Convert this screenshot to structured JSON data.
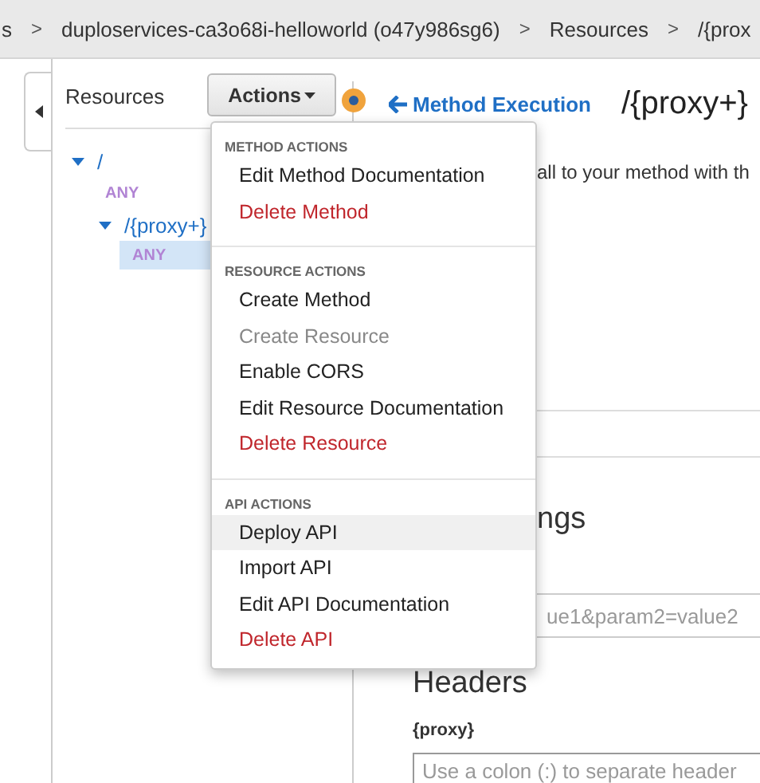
{
  "breadcrumb": [
    {
      "kind": "crumb",
      "text": "s"
    },
    {
      "kind": "separator",
      "text": ">"
    },
    {
      "kind": "crumb",
      "text": "duploservices-ca3o68i-helloworld (o47y986sg6)"
    },
    {
      "kind": "separator",
      "text": ">"
    },
    {
      "kind": "crumb",
      "text": "Resources"
    },
    {
      "kind": "separator",
      "text": ">"
    },
    {
      "kind": "crumb",
      "text": "/{prox"
    }
  ],
  "resources": {
    "title": "Resources",
    "actions_button": "Actions",
    "tree": [
      {
        "label": "/",
        "kind": "resource",
        "expanded": true,
        "selected": false,
        "children": [
          {
            "label": "ANY",
            "kind": "method",
            "selected": false
          },
          {
            "label": "/{proxy+}",
            "kind": "resource",
            "expanded": true,
            "selected": false,
            "children": [
              {
                "label": "ANY",
                "kind": "method",
                "selected": true
              }
            ]
          }
        ]
      }
    ]
  },
  "menu": {
    "sections": [
      {
        "title": "METHOD ACTIONS",
        "items": [
          {
            "label": "Edit Method Documentation",
            "kind": "normal",
            "highlighted": false
          },
          {
            "label": "Delete Method",
            "kind": "danger",
            "highlighted": false
          }
        ]
      },
      {
        "title": "RESOURCE ACTIONS",
        "items": [
          {
            "label": "Create Method",
            "kind": "normal",
            "highlighted": false
          },
          {
            "label": "Create Resource",
            "kind": "disabled",
            "highlighted": false
          },
          {
            "label": "Enable CORS",
            "kind": "normal",
            "highlighted": false
          },
          {
            "label": "Edit Resource Documentation",
            "kind": "normal",
            "highlighted": false
          },
          {
            "label": "Delete Resource",
            "kind": "danger",
            "highlighted": false
          }
        ]
      },
      {
        "title": "API ACTIONS",
        "items": [
          {
            "label": "Deploy API",
            "kind": "normal",
            "highlighted": true
          },
          {
            "label": "Import API",
            "kind": "normal",
            "highlighted": false
          },
          {
            "label": "Edit API Documentation",
            "kind": "normal",
            "highlighted": false
          },
          {
            "label": "Delete API",
            "kind": "danger",
            "highlighted": false
          }
        ]
      }
    ]
  },
  "detail": {
    "back_link": "Method Execution",
    "title": "/{proxy+}",
    "description": "all to your method with th",
    "settings_heading": "ngs",
    "query_field": {
      "placeholder": "ue1&param2=value2"
    },
    "headers_heading": "Headers",
    "header_label": "{proxy}",
    "header_field": {
      "placeholder": "Use a colon (:) to separate header"
    }
  }
}
